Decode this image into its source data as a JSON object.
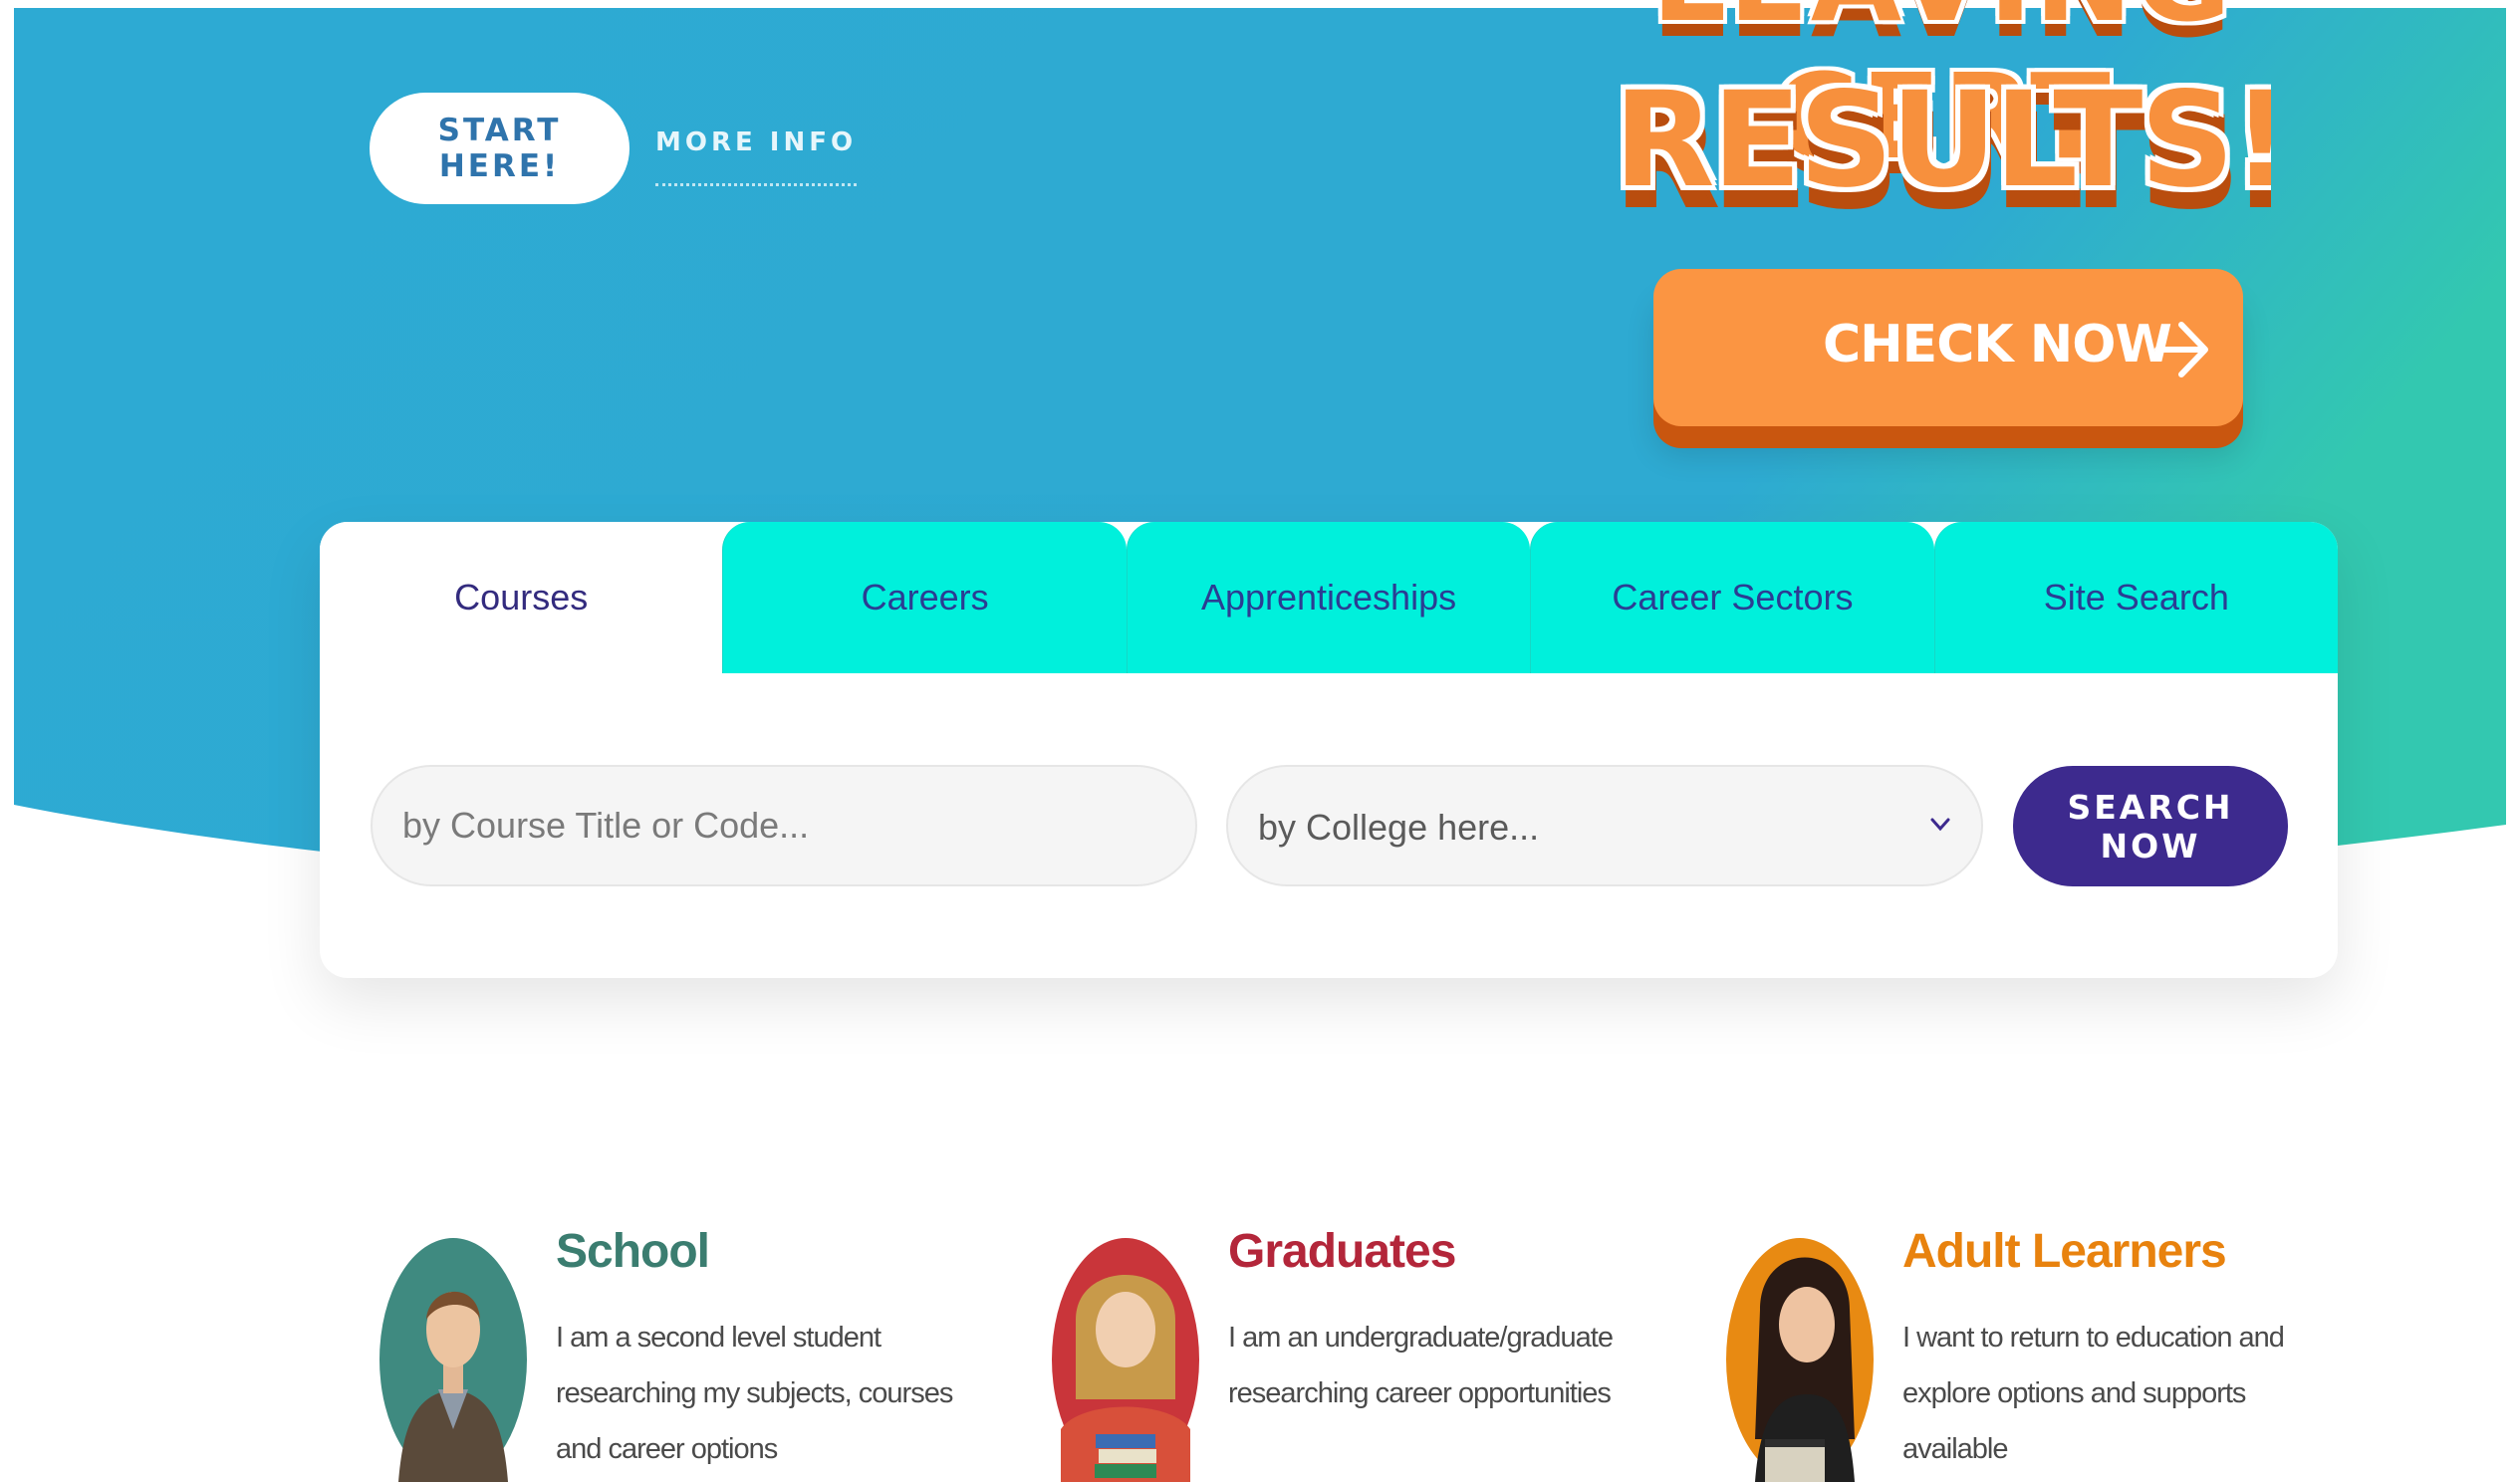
{
  "hero": {
    "start_label": "START HERE!",
    "more_info_label": "MORE INFO"
  },
  "promo": {
    "title_top": "LEAVING CERT",
    "title_main": "RESULTS!",
    "check_label": "CHECK NOW"
  },
  "search": {
    "tabs": [
      {
        "label": "Courses",
        "active": true
      },
      {
        "label": "Careers",
        "active": false
      },
      {
        "label": "Apprenticeships",
        "active": false
      },
      {
        "label": "Career Sectors",
        "active": false
      },
      {
        "label": "Site Search",
        "active": false
      }
    ],
    "course_placeholder": "by Course Title or Code...",
    "college_value": "by College here...",
    "search_label": "SEARCH NOW"
  },
  "audiences": [
    {
      "title": "School",
      "color": "#3b7d70",
      "desc": "I am a second level student researching my subjects, courses and career options"
    },
    {
      "title": "Graduates",
      "color": "#b3263a",
      "desc": "I am an undergraduate/graduate researching career opportunities"
    },
    {
      "title": "Adult Learners",
      "color": "#e8820e",
      "desc": "I want to return to education and explore options and supports available"
    }
  ],
  "colors": {
    "hero_blue": "#2eaad2",
    "hero_teal": "#2fc9b2",
    "tab_teal": "#00f0dc",
    "orange": "#fb9542",
    "purple": "#3d2a8e"
  }
}
